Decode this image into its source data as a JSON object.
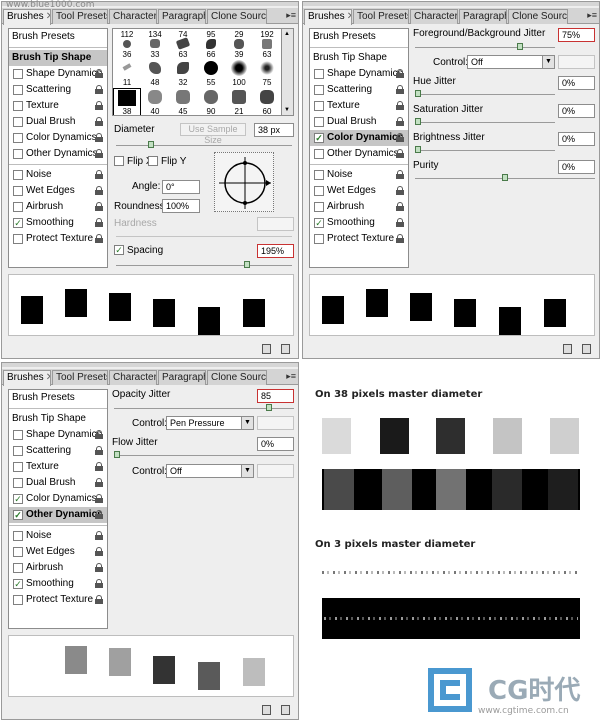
{
  "watermark_top": "www.blue1000.com",
  "tabs": [
    "Brushes",
    "Tool Presets",
    "Character",
    "Paragraph",
    "Clone Source"
  ],
  "sidebar": {
    "header": "Brush Presets",
    "tip_shape": "Brush Tip Shape",
    "items": [
      "Shape Dynamics",
      "Scattering",
      "Texture",
      "Dual Brush",
      "Color Dynamics",
      "Other Dynamics",
      "Noise",
      "Wet Edges",
      "Airbrush",
      "Smoothing",
      "Protect Texture"
    ]
  },
  "panel1": {
    "brush_numbers_top": [
      "112",
      "134",
      "74",
      "95",
      "29",
      "192"
    ],
    "brush_numbers_r1": [
      "36",
      "33",
      "63",
      "66",
      "39",
      "63"
    ],
    "brush_numbers_r2": [
      "11",
      "48",
      "32",
      "55",
      "100",
      "75"
    ],
    "brush_numbers_r3": [
      "38",
      "40",
      "45",
      "90",
      "21",
      "60"
    ],
    "diameter_label": "Diameter",
    "use_sample_size": "Use Sample Size",
    "diameter_value": "38 px",
    "flip_x": "Flip X",
    "flip_y": "Flip Y",
    "angle_label": "Angle:",
    "angle_value": "0°",
    "roundness_label": "Roundness:",
    "roundness_value": "100%",
    "hardness_label": "Hardness",
    "spacing_label": "Spacing",
    "spacing_value": "195%",
    "checked": [
      "Smoothing"
    ]
  },
  "panel2": {
    "fg_bg_jitter_label": "Foreground/Background Jitter",
    "fg_bg_jitter_value": "75%",
    "control_label": "Control:",
    "control_value": "Off",
    "hue_jitter_label": "Hue Jitter",
    "hue_jitter_value": "0%",
    "saturation_jitter_label": "Saturation Jitter",
    "saturation_jitter_value": "0%",
    "brightness_jitter_label": "Brightness Jitter",
    "brightness_jitter_value": "0%",
    "purity_label": "Purity",
    "purity_value": "0%",
    "checked": [
      "Color Dynamics",
      "Smoothing"
    ],
    "selected": "Color Dynamics"
  },
  "panel3": {
    "opacity_jitter_label": "Opacity Jitter",
    "opacity_jitter_value": "85",
    "control_label": "Control:",
    "control_value_1": "Pen Pressure",
    "flow_jitter_label": "Flow Jitter",
    "flow_jitter_value": "0%",
    "control_value_2": "Off",
    "checked": [
      "Color Dynamics",
      "Other Dynamics",
      "Smoothing"
    ],
    "selected": "Other Dynamics"
  },
  "result": {
    "title_38": "On 38 pixels master diameter",
    "title_3": "On 3 pixels master diameter"
  },
  "logo": {
    "brand": "CG时代",
    "url": "www.cgtime.com.cn"
  },
  "colors": {
    "panel_bg": "#eeeeee",
    "field_highlight": "#c83232",
    "slider_thumb": "#c2e0c2"
  }
}
